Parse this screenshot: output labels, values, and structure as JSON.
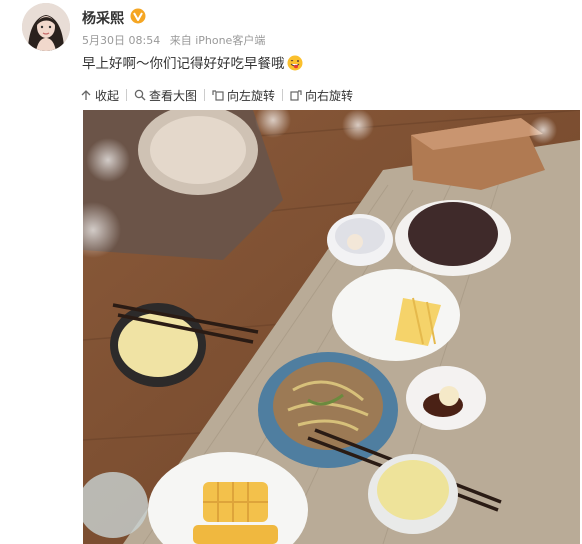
{
  "post": {
    "username": "杨采熙",
    "date": "5月30日 08:54",
    "source": "来自 iPhone客户端",
    "content": "早上好啊～你们记得好好吃早餐哦"
  },
  "toolbar": {
    "collapse": "收起",
    "view_large": "查看大图",
    "rotate_left": "向左旋转",
    "rotate_right": "向右旋转"
  },
  "icons": {
    "verified": "verified-badge-icon",
    "emoji": "tongue-wink-emoji-icon",
    "collapse": "arrow-up-icon",
    "view_large": "magnifier-icon",
    "rotate_left": "rotate-left-icon",
    "rotate_right": "rotate-right-icon"
  },
  "colors": {
    "verified": "#f5a623",
    "text": "#333333",
    "meta": "#999999"
  }
}
